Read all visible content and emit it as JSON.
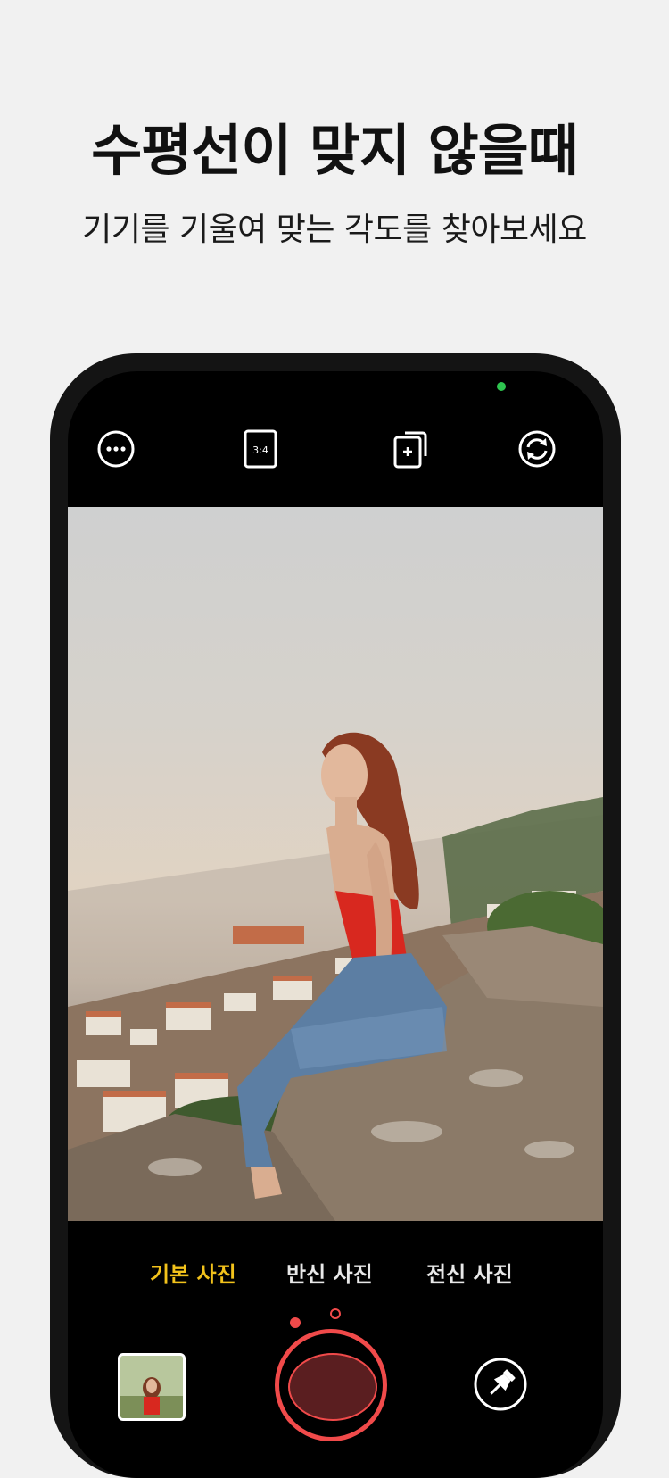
{
  "headline": "수평선이 맞지 않을때",
  "subline": "기기를 기울여 맞는 각도를 찾아보세요",
  "toolbar": {
    "more": "more-icon",
    "ratio": "3:4",
    "layout": "layout-add-icon",
    "switch": "camera-switch-icon"
  },
  "modes": [
    "기본 사진",
    "반신 사진",
    "전신 사진"
  ],
  "active_mode": "기본 사진",
  "colors": {
    "accent_red": "#f04a4a",
    "active_yellow": "#f2c21b",
    "indicator_green": "#2ec44f"
  }
}
